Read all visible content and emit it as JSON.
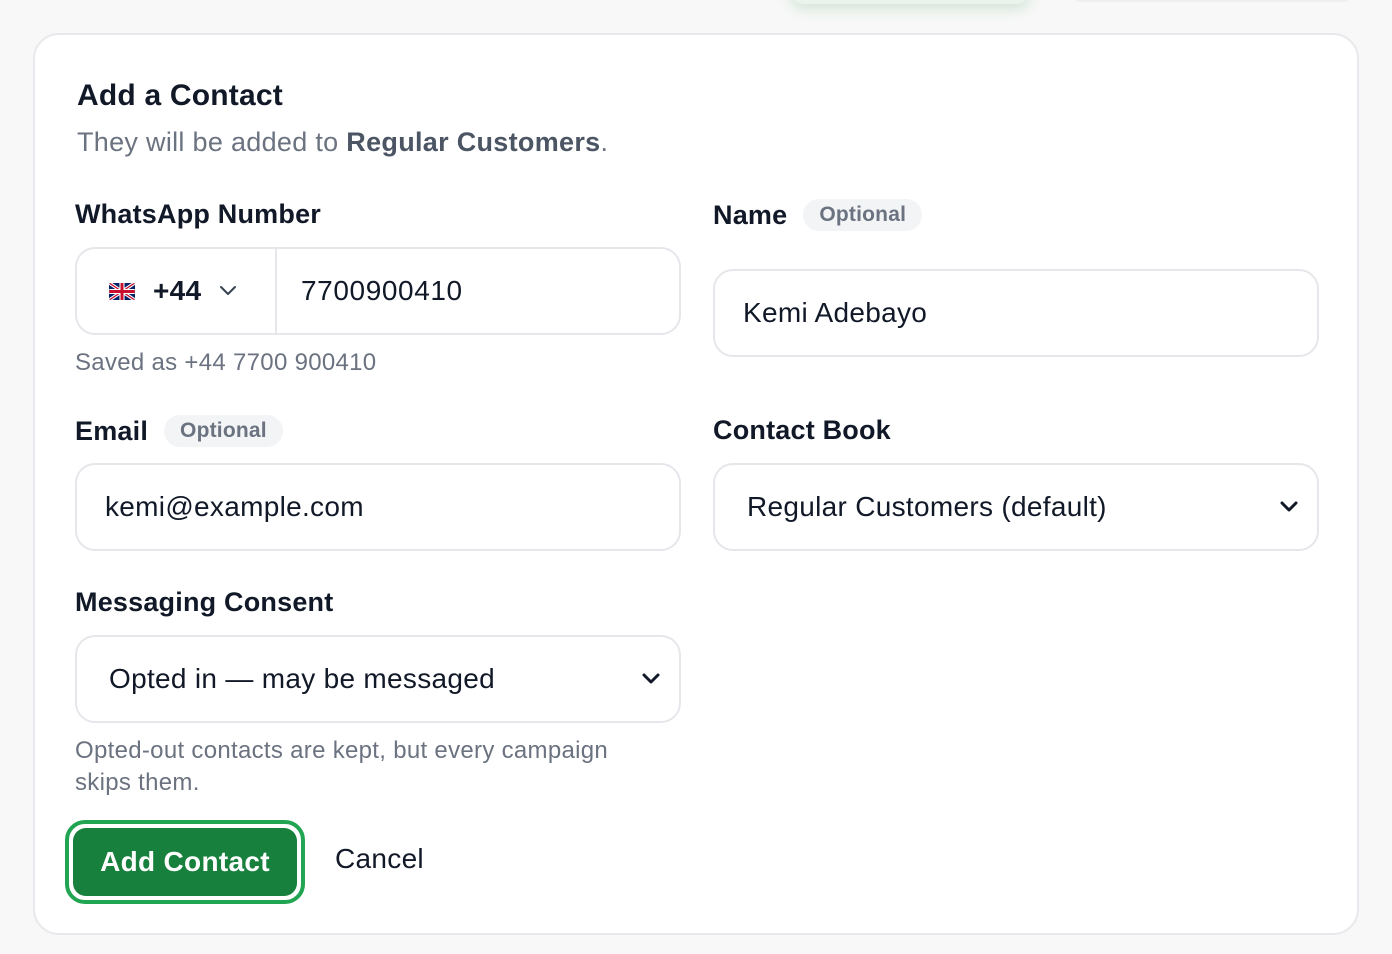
{
  "dialog": {
    "title": "Add a Contact",
    "subtitle_prefix": "They will be added to",
    "subtitle_book": "Regular Customers",
    "subtitle_suffix": "."
  },
  "whatsapp": {
    "label": "WhatsApp Number",
    "country_flag": "uk-flag-icon",
    "country_code": "+44",
    "number": "7700900410",
    "saved_as": "Saved as +44 7700 900410"
  },
  "name": {
    "label": "Name",
    "badge": "Optional",
    "value": "Kemi Adebayo"
  },
  "email": {
    "label": "Email",
    "badge": "Optional",
    "value": "kemi@example.com"
  },
  "contact_book": {
    "label": "Contact Book",
    "selected": "Regular Customers (default)"
  },
  "consent": {
    "label": "Messaging Consent",
    "selected": "Opted in — may be messaged",
    "help": "Opted-out contacts are kept, but every campaign skips them."
  },
  "actions": {
    "submit": "Add Contact",
    "cancel": "Cancel"
  },
  "colors": {
    "primary": "#17803c",
    "focus_ring": "#22a552",
    "muted_text": "#6b7280",
    "border": "#e5e7eb"
  }
}
